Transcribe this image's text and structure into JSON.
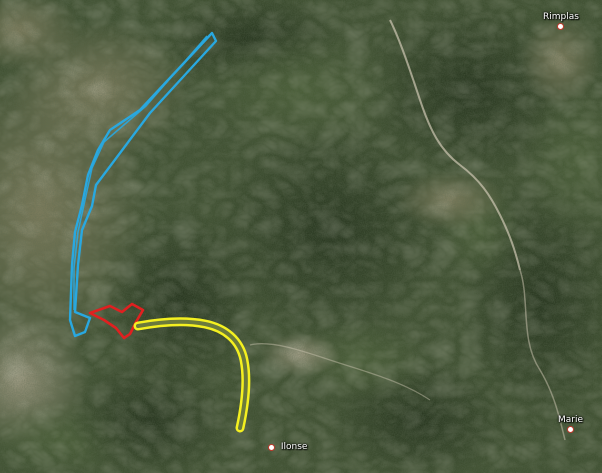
{
  "map": {
    "places": [
      {
        "name": "Rimplas"
      },
      {
        "name": "Ilonse"
      },
      {
        "name": "Marie"
      }
    ],
    "overlays": [
      {
        "id": "blue-zone",
        "color": "#29a8e0"
      },
      {
        "id": "red-zone",
        "color": "#e02020"
      },
      {
        "id": "yellow-route",
        "color": "#f4f020"
      }
    ],
    "colors": {
      "forest_dark": "#27361c",
      "forest": "#3d5230",
      "rock_light": "#a39a82",
      "valley_road": "#cfc8b4"
    }
  }
}
